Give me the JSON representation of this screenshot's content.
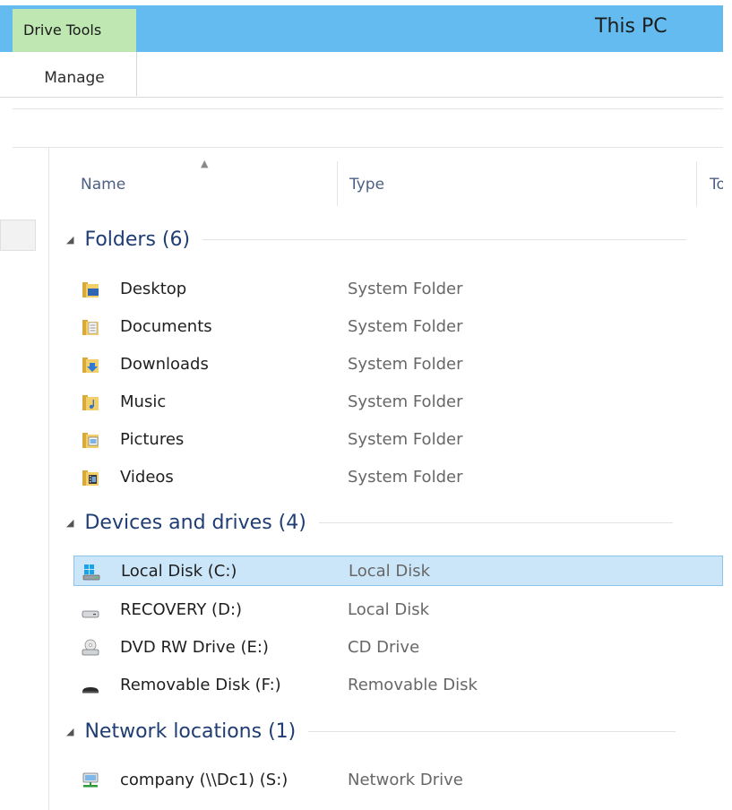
{
  "ribbon": {
    "context_tab": "Drive Tools",
    "context_tab_color": "#bfe7b2",
    "titlebar_color": "#63bbf0",
    "sub_tab": "Manage",
    "window_title": "This PC"
  },
  "columns": {
    "name": "Name",
    "type": "Type",
    "third": "To"
  },
  "groups": [
    {
      "title": "Folders (6)",
      "items": [
        {
          "name": "Desktop",
          "type": "System Folder",
          "icon": "desktop-folder-icon"
        },
        {
          "name": "Documents",
          "type": "System Folder",
          "icon": "documents-folder-icon"
        },
        {
          "name": "Downloads",
          "type": "System Folder",
          "icon": "downloads-folder-icon"
        },
        {
          "name": "Music",
          "type": "System Folder",
          "icon": "music-folder-icon"
        },
        {
          "name": "Pictures",
          "type": "System Folder",
          "icon": "pictures-folder-icon"
        },
        {
          "name": "Videos",
          "type": "System Folder",
          "icon": "videos-folder-icon"
        }
      ]
    },
    {
      "title": "Devices and drives (4)",
      "items": [
        {
          "name": "Local Disk (C:)",
          "type": "Local Disk",
          "icon": "windows-drive-icon",
          "selected": true
        },
        {
          "name": "RECOVERY (D:)",
          "type": "Local Disk",
          "icon": "hard-drive-icon"
        },
        {
          "name": "DVD RW Drive (E:)",
          "type": "CD Drive",
          "icon": "dvd-drive-icon"
        },
        {
          "name": "Removable Disk (F:)",
          "type": "Removable Disk",
          "icon": "removable-disk-icon"
        }
      ]
    },
    {
      "title": "Network locations (1)",
      "items": [
        {
          "name": "company (\\\\Dc1) (S:)",
          "type": "Network Drive",
          "icon": "network-drive-icon"
        }
      ]
    }
  ]
}
